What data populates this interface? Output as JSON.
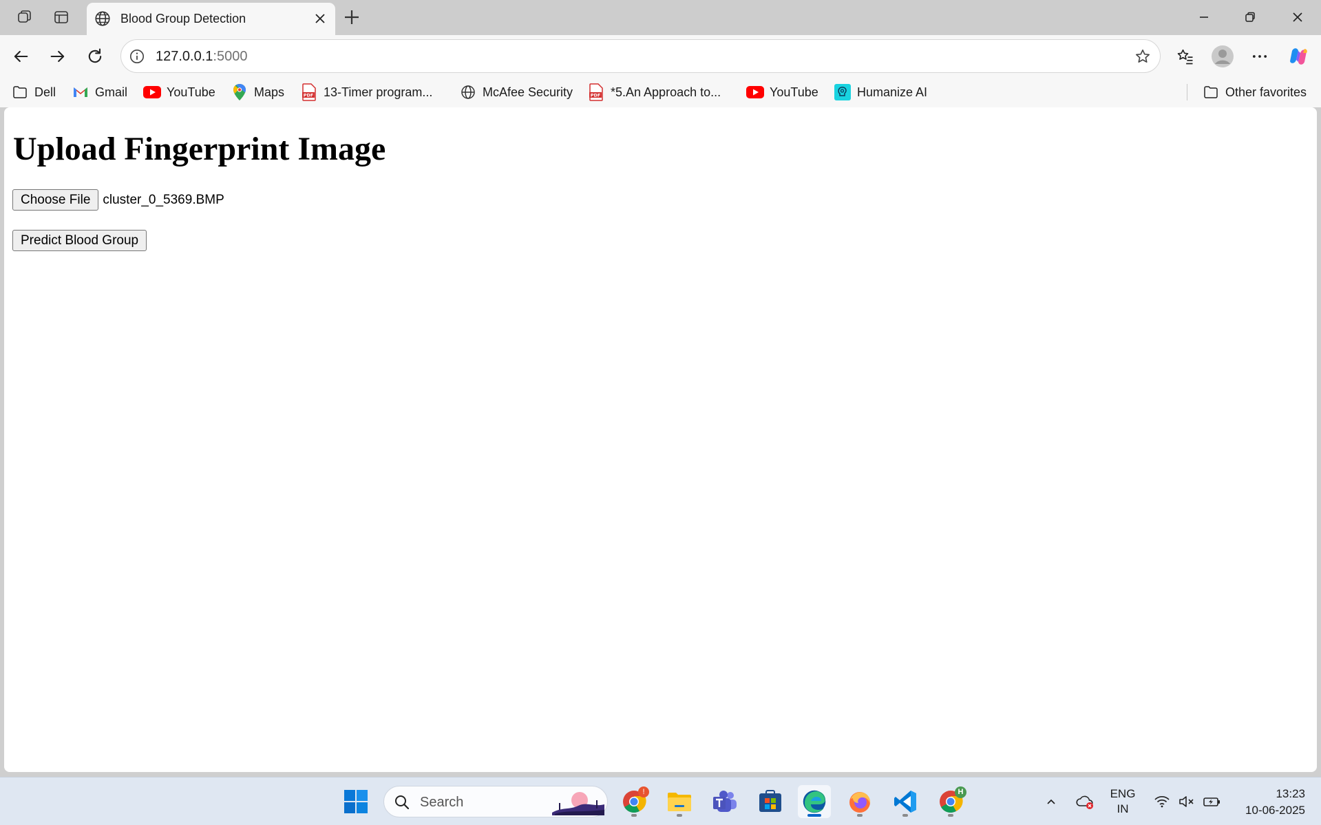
{
  "browser": {
    "tab": {
      "title": "Blood Group Detection"
    },
    "address": {
      "host": "127.0.0.1",
      "port": ":5000"
    },
    "bookmarks": [
      {
        "label": "Dell",
        "icon": "folder-icon"
      },
      {
        "label": "Gmail",
        "icon": "gmail-icon"
      },
      {
        "label": "YouTube",
        "icon": "youtube-icon"
      },
      {
        "label": "Maps",
        "icon": "maps-icon"
      },
      {
        "label": "13-Timer program...",
        "icon": "pdf-icon"
      },
      {
        "label": "McAfee Security",
        "icon": "globe-icon"
      },
      {
        "label": "*5.An Approach to...",
        "icon": "pdf-icon"
      },
      {
        "label": "YouTube",
        "icon": "youtube-icon"
      },
      {
        "label": "Humanize AI",
        "icon": "humanize-icon"
      }
    ],
    "other_favorites": "Other favorites"
  },
  "page": {
    "heading": "Upload Fingerprint Image",
    "choose_file_label": "Choose File",
    "file_name": "cluster_0_5369.BMP",
    "predict_label": "Predict Blood Group"
  },
  "taskbar": {
    "search_placeholder": "Search",
    "language": {
      "line1": "ENG",
      "line2": "IN"
    },
    "time": "13:23",
    "date": "10-06-2025",
    "badges": {
      "chrome": "!",
      "chrome_profile": "H"
    }
  },
  "colors": {
    "accent": "#0a64c8",
    "youtube_red": "#ff0000",
    "pdf_red": "#d32f2f"
  }
}
